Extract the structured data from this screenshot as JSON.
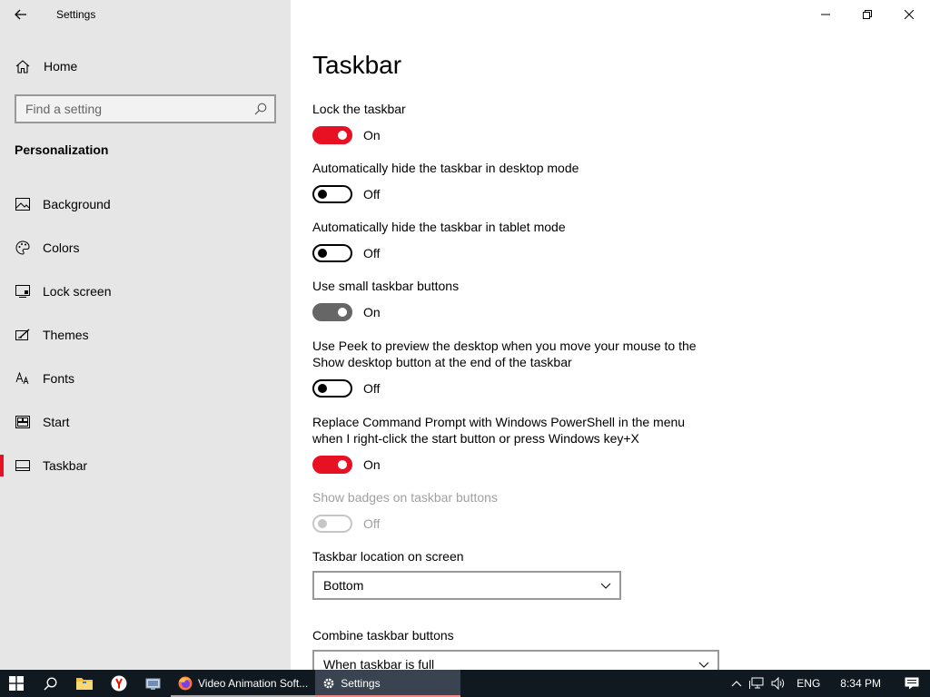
{
  "window": {
    "app_title": "Settings",
    "controls": [
      "minimize-icon",
      "restore-icon",
      "close-icon"
    ]
  },
  "sidebar": {
    "home_label": "Home",
    "search_placeholder": "Find a setting",
    "section_title": "Personalization",
    "items": [
      {
        "label": "Background",
        "icon": "picture-icon"
      },
      {
        "label": "Colors",
        "icon": "palette-icon"
      },
      {
        "label": "Lock screen",
        "icon": "lock-screen-icon"
      },
      {
        "label": "Themes",
        "icon": "themes-icon"
      },
      {
        "label": "Fonts",
        "icon": "fonts-icon"
      },
      {
        "label": "Start",
        "icon": "start-icon"
      },
      {
        "label": "Taskbar",
        "icon": "taskbar-icon",
        "active": true
      }
    ]
  },
  "main": {
    "title": "Taskbar",
    "settings": [
      {
        "label": "Lock the taskbar",
        "state": "On",
        "on": true
      },
      {
        "label": "Automatically hide the taskbar in desktop mode",
        "state": "Off",
        "on": false
      },
      {
        "label": "Automatically hide the taskbar in tablet mode",
        "state": "Off",
        "on": false
      },
      {
        "label": "Use small taskbar buttons",
        "state": "On",
        "on": true
      },
      {
        "label": "Use Peek to preview the desktop when you move your mouse to the Show desktop button at the end of the taskbar",
        "state": "Off",
        "on": false
      },
      {
        "label": "Replace Command Prompt with Windows PowerShell in the menu when I right-click the start button or press Windows key+X",
        "state": "On",
        "on": true
      },
      {
        "label": "Show badges on taskbar buttons",
        "state": "Off",
        "on": false,
        "disabled": true
      }
    ],
    "location_label": "Taskbar location on screen",
    "location_value": "Bottom",
    "combine_label": "Combine taskbar buttons",
    "combine_value": "When taskbar is full"
  },
  "taskbar": {
    "apps": [
      {
        "label": "Video Animation Soft...",
        "icon": "firefox-icon"
      },
      {
        "label": "Settings",
        "icon": "gear-icon"
      }
    ],
    "language": "ENG",
    "time": "8:34 PM"
  },
  "colors": {
    "accent": "#e81123",
    "sidebar_bg": "#e6e6e6",
    "taskbar_bg": "#101820"
  }
}
